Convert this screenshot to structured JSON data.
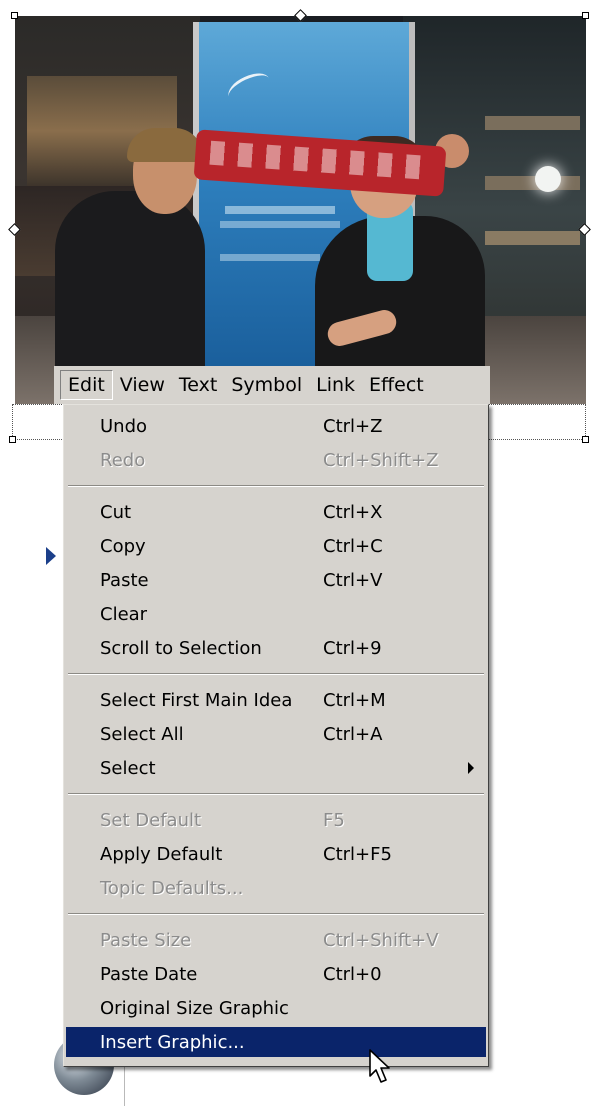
{
  "menubar": {
    "items": [
      "Edit",
      "View",
      "Text",
      "Symbol",
      "Link",
      "Effect"
    ]
  },
  "edit_menu": {
    "items": [
      {
        "label": "Undo",
        "shortcut": "Ctrl+Z",
        "enabled": true
      },
      {
        "label": "Redo",
        "shortcut": "Ctrl+Shift+Z",
        "enabled": false
      },
      {
        "label": "Cut",
        "shortcut": "Ctrl+X",
        "enabled": true
      },
      {
        "label": "Copy",
        "shortcut": "Ctrl+C",
        "enabled": true
      },
      {
        "label": "Paste",
        "shortcut": "Ctrl+V",
        "enabled": true
      },
      {
        "label": "Clear",
        "shortcut": "",
        "enabled": true
      },
      {
        "label": "Scroll to Selection",
        "shortcut": "Ctrl+9",
        "enabled": true
      },
      {
        "label": "Select First Main Idea",
        "shortcut": "Ctrl+M",
        "enabled": true
      },
      {
        "label": "Select All",
        "shortcut": "Ctrl+A",
        "enabled": true
      },
      {
        "label": "Select",
        "shortcut": "",
        "enabled": true,
        "submenu": true
      },
      {
        "label": "Set Default",
        "shortcut": "F5",
        "enabled": false
      },
      {
        "label": "Apply Default",
        "shortcut": "Ctrl+F5",
        "enabled": true
      },
      {
        "label": "Topic Defaults...",
        "shortcut": "",
        "enabled": false
      },
      {
        "label": "Paste Size",
        "shortcut": "Ctrl+Shift+V",
        "enabled": false
      },
      {
        "label": "Paste Date",
        "shortcut": "Ctrl+0",
        "enabled": true
      },
      {
        "label": "Original Size Graphic",
        "shortcut": "",
        "enabled": true
      },
      {
        "label": "Insert Graphic...",
        "shortcut": "",
        "enabled": true,
        "highlighted": true
      }
    ]
  },
  "colors": {
    "menu_bg": "#d6d3ce",
    "highlight": "#0a246a",
    "disabled_text": "#8c8c8c"
  }
}
